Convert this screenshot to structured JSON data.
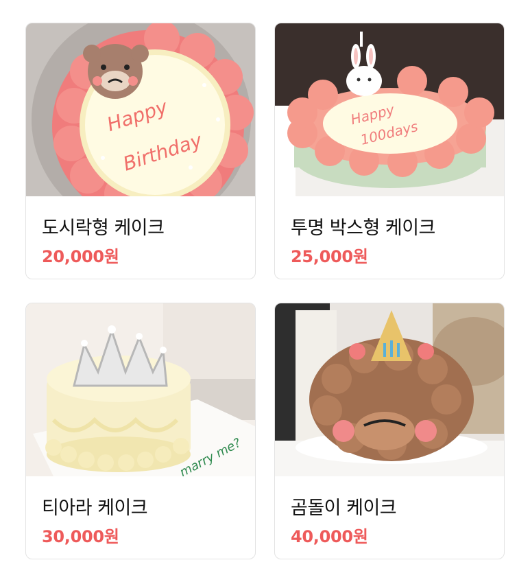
{
  "products": [
    {
      "name": "도시락형 케이크",
      "price": "20,000원",
      "image": "bear-birthday-cake-image"
    },
    {
      "name": "투명 박스형 케이크",
      "price": "25,000원",
      "image": "bunny-100days-cake-image"
    },
    {
      "name": "티아라 케이크",
      "price": "30,000원",
      "image": "tiara-cake-image"
    },
    {
      "name": "곰돌이 케이크",
      "price": "40,000원",
      "image": "poodle-bear-cake-image"
    }
  ],
  "colors": {
    "price": "#ee5a5a",
    "border": "#e3e3e3",
    "title": "#111111"
  }
}
